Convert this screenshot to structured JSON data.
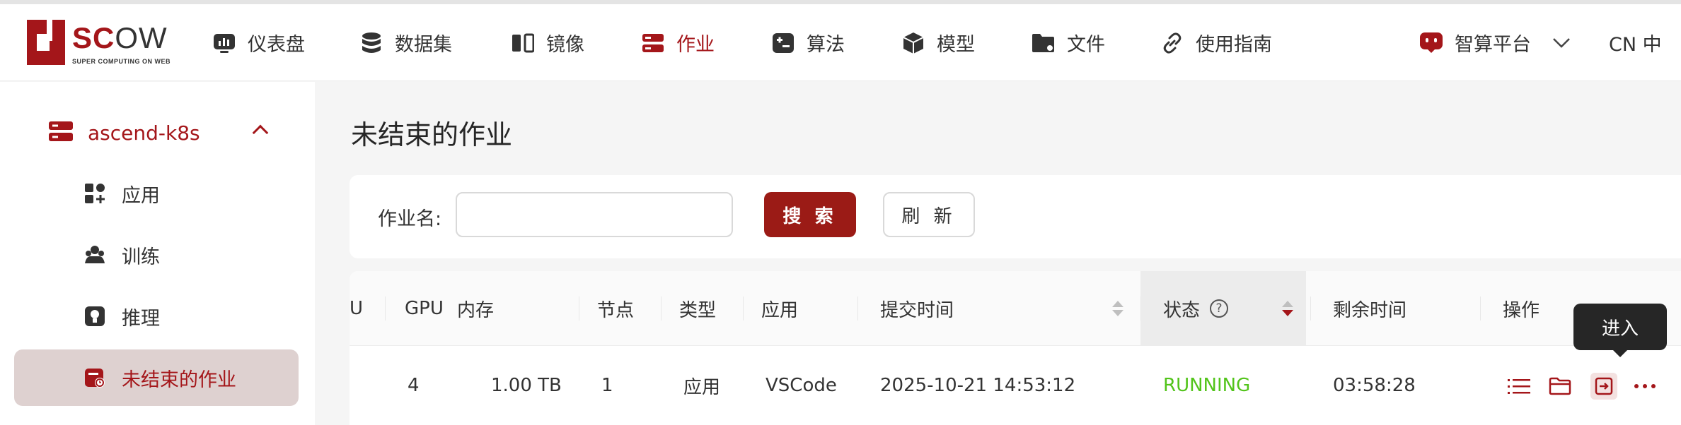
{
  "brand": {
    "name": "SCOW",
    "subtitle": "SUPER COMPUTING ON WEB",
    "color": "#a4161a"
  },
  "nav": {
    "items": [
      {
        "label": "仪表盘",
        "icon": "dashboard-icon"
      },
      {
        "label": "数据集",
        "icon": "database-icon"
      },
      {
        "label": "镜像",
        "icon": "image-icon"
      },
      {
        "label": "作业",
        "icon": "job-icon",
        "active": true
      },
      {
        "label": "算法",
        "icon": "algorithm-icon"
      },
      {
        "label": "模型",
        "icon": "model-cube-icon"
      },
      {
        "label": "文件",
        "icon": "folder-icon"
      },
      {
        "label": "使用指南",
        "icon": "link-icon"
      }
    ],
    "platform": "智算平台",
    "language": "CN 中"
  },
  "sidebar": {
    "cluster": "ascend-k8s",
    "items": [
      {
        "label": "应用",
        "icon": "apps-icon"
      },
      {
        "label": "训练",
        "icon": "training-icon"
      },
      {
        "label": "推理",
        "icon": "inference-icon"
      },
      {
        "label": "未结束的作业",
        "icon": "running-job-icon",
        "active": true
      }
    ]
  },
  "main": {
    "title": "未结束的作业",
    "search": {
      "label": "作业名:",
      "value": "",
      "placeholder": "",
      "search_button": "搜 索",
      "refresh_button": "刷 新"
    },
    "table": {
      "columns": [
        "U",
        "GPU",
        "内存",
        "节点",
        "类型",
        "应用",
        "提交时间",
        "状态",
        "剩余时间",
        "操作"
      ],
      "rows": [
        {
          "gpu": "4",
          "memory": "1.00 TB",
          "nodes": "1",
          "type": "应用",
          "app": "VSCode",
          "submit_time": "2025-10-21 14:53:12",
          "status": "RUNNING",
          "remaining": "03:58:28"
        }
      ],
      "status_help": "?",
      "status_color": "#52c41a"
    },
    "tooltip": "进入"
  }
}
